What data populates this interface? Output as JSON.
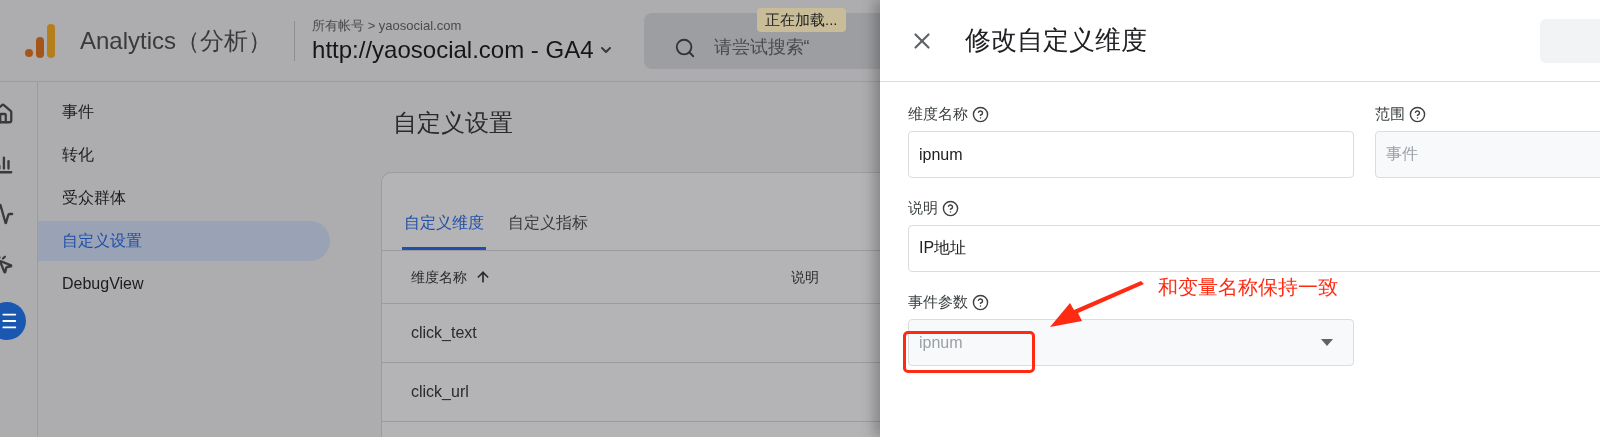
{
  "app": {
    "name": "Analytics（分析）",
    "breadcrumb": "所有帐号 > yaosocial.com",
    "property": "http://yaosocial.com - GA4"
  },
  "search": {
    "placeholder": "请尝试搜索“"
  },
  "loading_tooltip": "正在加载...",
  "rail": [
    {
      "kind": "home",
      "selected": false
    },
    {
      "kind": "reports",
      "selected": false
    },
    {
      "kind": "explore",
      "selected": false
    },
    {
      "kind": "advertising",
      "selected": false
    },
    {
      "kind": "configure",
      "selected": true
    }
  ],
  "sidebar": {
    "items": [
      {
        "label": "事件",
        "selected": false
      },
      {
        "label": "转化",
        "selected": false
      },
      {
        "label": "受众群体",
        "selected": false
      },
      {
        "label": "自定义设置",
        "selected": true
      },
      {
        "label": "DebugView",
        "selected": false
      }
    ]
  },
  "page": {
    "title": "自定义设置",
    "tabs": [
      {
        "label": "自定义维度",
        "selected": true
      },
      {
        "label": "自定义指标",
        "selected": false
      }
    ],
    "table": {
      "columns": [
        {
          "label": "维度名称",
          "sorted": true
        },
        {
          "label": "说明",
          "sorted": false
        }
      ],
      "rows": [
        [
          "click_text"
        ],
        [
          "click_url"
        ]
      ]
    }
  },
  "drawer": {
    "title": "修改自定义维度",
    "rows": [
      [
        {
          "kind": "text",
          "label": "维度名称",
          "value": "ipnum",
          "disabled": false
        },
        {
          "kind": "text",
          "label": "范围",
          "value": "事件",
          "disabled": true
        }
      ],
      [
        {
          "kind": "text",
          "label": "说明",
          "value": "IP地址",
          "disabled": false
        }
      ],
      [
        {
          "kind": "select",
          "label": "事件参数",
          "value": "ipnum",
          "disabled": true
        }
      ]
    ]
  },
  "annotation": {
    "text": "和变量名称保持一致"
  }
}
